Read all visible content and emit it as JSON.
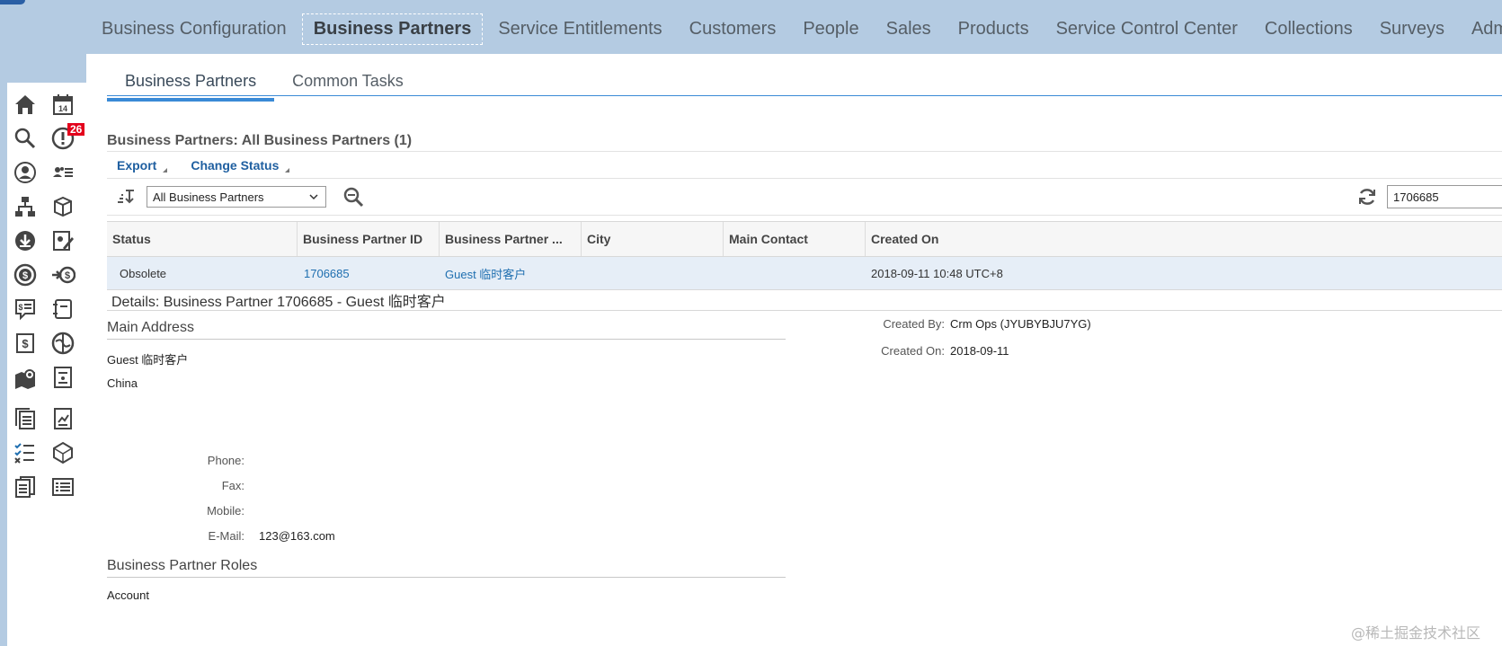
{
  "top_nav": {
    "items": [
      "Business Configuration",
      "Business Partners",
      "Service Entitlements",
      "Customers",
      "People",
      "Sales",
      "Products",
      "Service Control Center",
      "Collections",
      "Surveys",
      "Adm"
    ],
    "active": "Business Partners"
  },
  "sidebar": {
    "calendar_day": "14",
    "alerts_badge": "26",
    "icons": [
      "home-icon",
      "calendar-icon",
      "search-icon",
      "alert-icon",
      "user-icon",
      "contacts-icon",
      "org-chart-icon",
      "product-box-icon",
      "download-icon",
      "edit-report-icon",
      "dollar-icon",
      "payment-transfer-icon",
      "quote-icon",
      "ledger-icon",
      "invoice-icon",
      "globe-refresh-icon",
      "map-location-icon",
      "doc-list-icon",
      "documents-icon",
      "report-chart-icon",
      "checklist-icon",
      "cube-icon",
      "pages-icon",
      "list-card-icon"
    ]
  },
  "subtabs": [
    "Business Partners",
    "Common Tasks"
  ],
  "list": {
    "title": "Business Partners: All Business Partners (1)",
    "actions": [
      "Export",
      "Change Status"
    ],
    "view_selected": "All Business Partners",
    "search_value": "1706685",
    "columns": [
      "Status",
      "Business Partner ID",
      "Business Partner ...",
      "City",
      "Main Contact",
      "Created On"
    ],
    "rows": [
      [
        "Obsolete",
        "1706685",
        "Guest 临时客户",
        "",
        "",
        "2018-09-11 10:48 UTC+8"
      ]
    ]
  },
  "details": {
    "title": "Details: Business Partner 1706685 - Guest 临时客户",
    "main_address": {
      "heading": "Main Address",
      "name": "Guest 临时客户",
      "country": "China"
    },
    "created_by_label": "Created By:",
    "created_by_value": "Crm Ops (JYUBYBJU7YG)",
    "created_on_label": "Created On:",
    "created_on_value": "2018-09-11",
    "contact": {
      "phone_label": "Phone:",
      "phone_value": "",
      "fax_label": "Fax:",
      "fax_value": "",
      "mobile_label": "Mobile:",
      "mobile_value": "",
      "email_label": "E-Mail:",
      "email_value": "123@163.com"
    },
    "roles": {
      "heading": "Business Partner Roles",
      "items": [
        "Account"
      ]
    }
  },
  "watermark": "@稀土掘金技术社区",
  "colors": {
    "nav_bg": "#b4cbe2",
    "accent": "#3a8ad6",
    "link": "#1f6fb0",
    "badge": "#e3001b",
    "selected_row": "#e6eef7"
  }
}
